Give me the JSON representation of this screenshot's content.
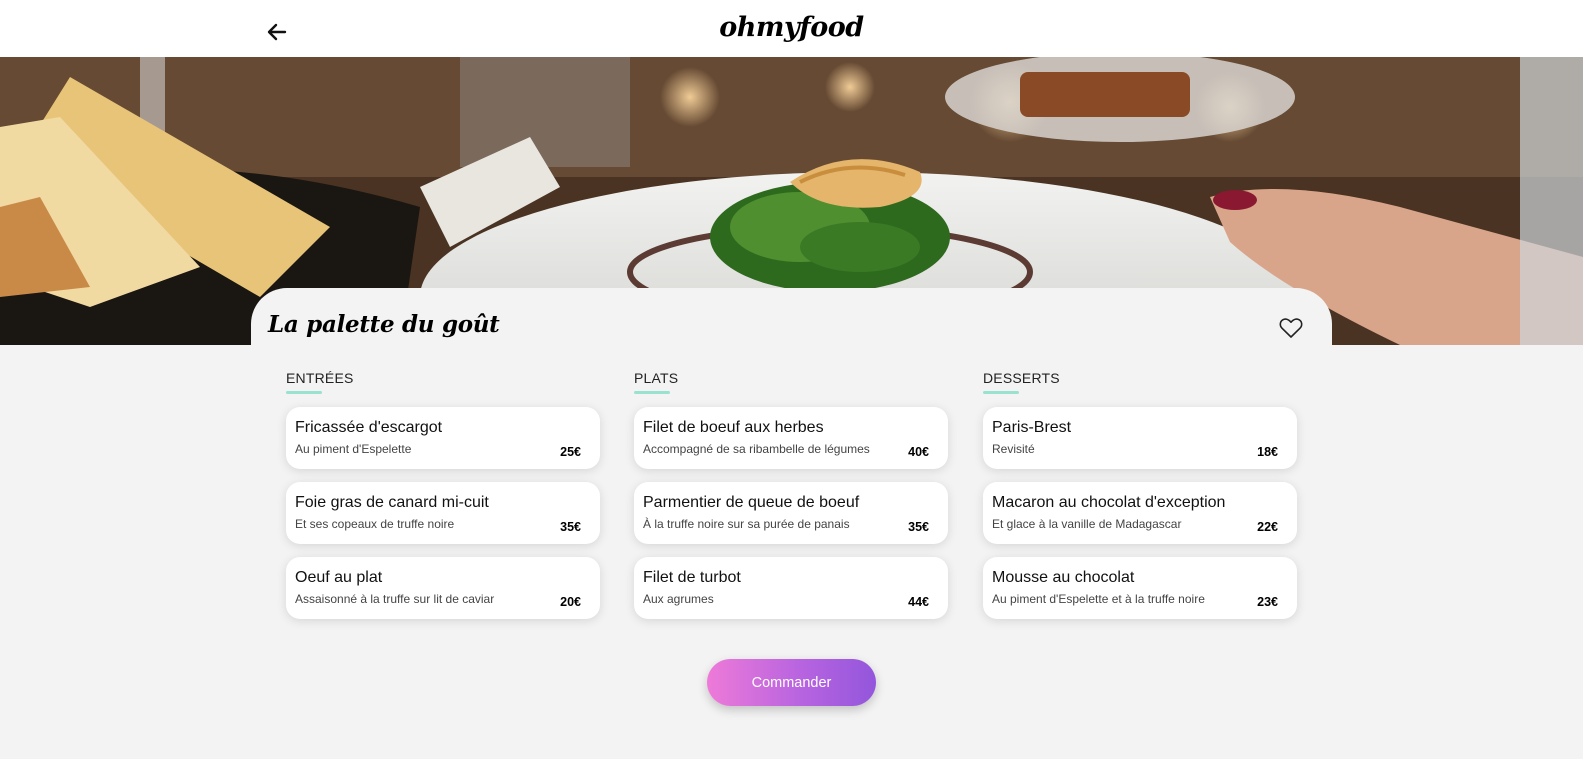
{
  "header": {
    "logo": "ohmyfood",
    "back_icon": "arrow-left-icon"
  },
  "hero": {
    "image": "restaurant-dish-photo"
  },
  "restaurant": {
    "name": "La palette du goût",
    "favorite_icon": "heart-outline-icon"
  },
  "menu": {
    "categories": [
      {
        "title": "ENTRÉES",
        "dishes": [
          {
            "name": "Fricassée d'escargot",
            "description": "Au piment d'Espelette",
            "price": "25€"
          },
          {
            "name": "Foie gras de canard mi-cuit",
            "description": "Et ses copeaux de truffe noire",
            "price": "35€"
          },
          {
            "name": "Oeuf au plat",
            "description": "Assaisonné à la truffe sur lit de caviar",
            "price": "20€"
          }
        ]
      },
      {
        "title": "PLATS",
        "dishes": [
          {
            "name": "Filet de boeuf aux herbes",
            "description": "Accompagné de sa ribambelle de légumes",
            "price": "40€"
          },
          {
            "name": "Parmentier de queue de boeuf",
            "description": "À la truffe noire sur sa purée de panais",
            "price": "35€"
          },
          {
            "name": "Filet de turbot",
            "description": "Aux agrumes",
            "price": "44€"
          }
        ]
      },
      {
        "title": "DESSERTS",
        "dishes": [
          {
            "name": "Paris-Brest",
            "description": "Revisité",
            "price": "18€"
          },
          {
            "name": "Macaron au chocolat d'exception",
            "description": "Et glace à la vanille de Madagascar",
            "price": "22€"
          },
          {
            "name": "Mousse au chocolat",
            "description": "Au piment d'Espelette et à la truffe noire",
            "price": "23€"
          }
        ]
      }
    ]
  },
  "order_button": {
    "label": "Commander"
  },
  "colors": {
    "accent_underline": "#99e2d0",
    "button_gradient_start": "#ee7ad8",
    "button_gradient_end": "#9356dc",
    "page_background": "#f3f3f3"
  }
}
